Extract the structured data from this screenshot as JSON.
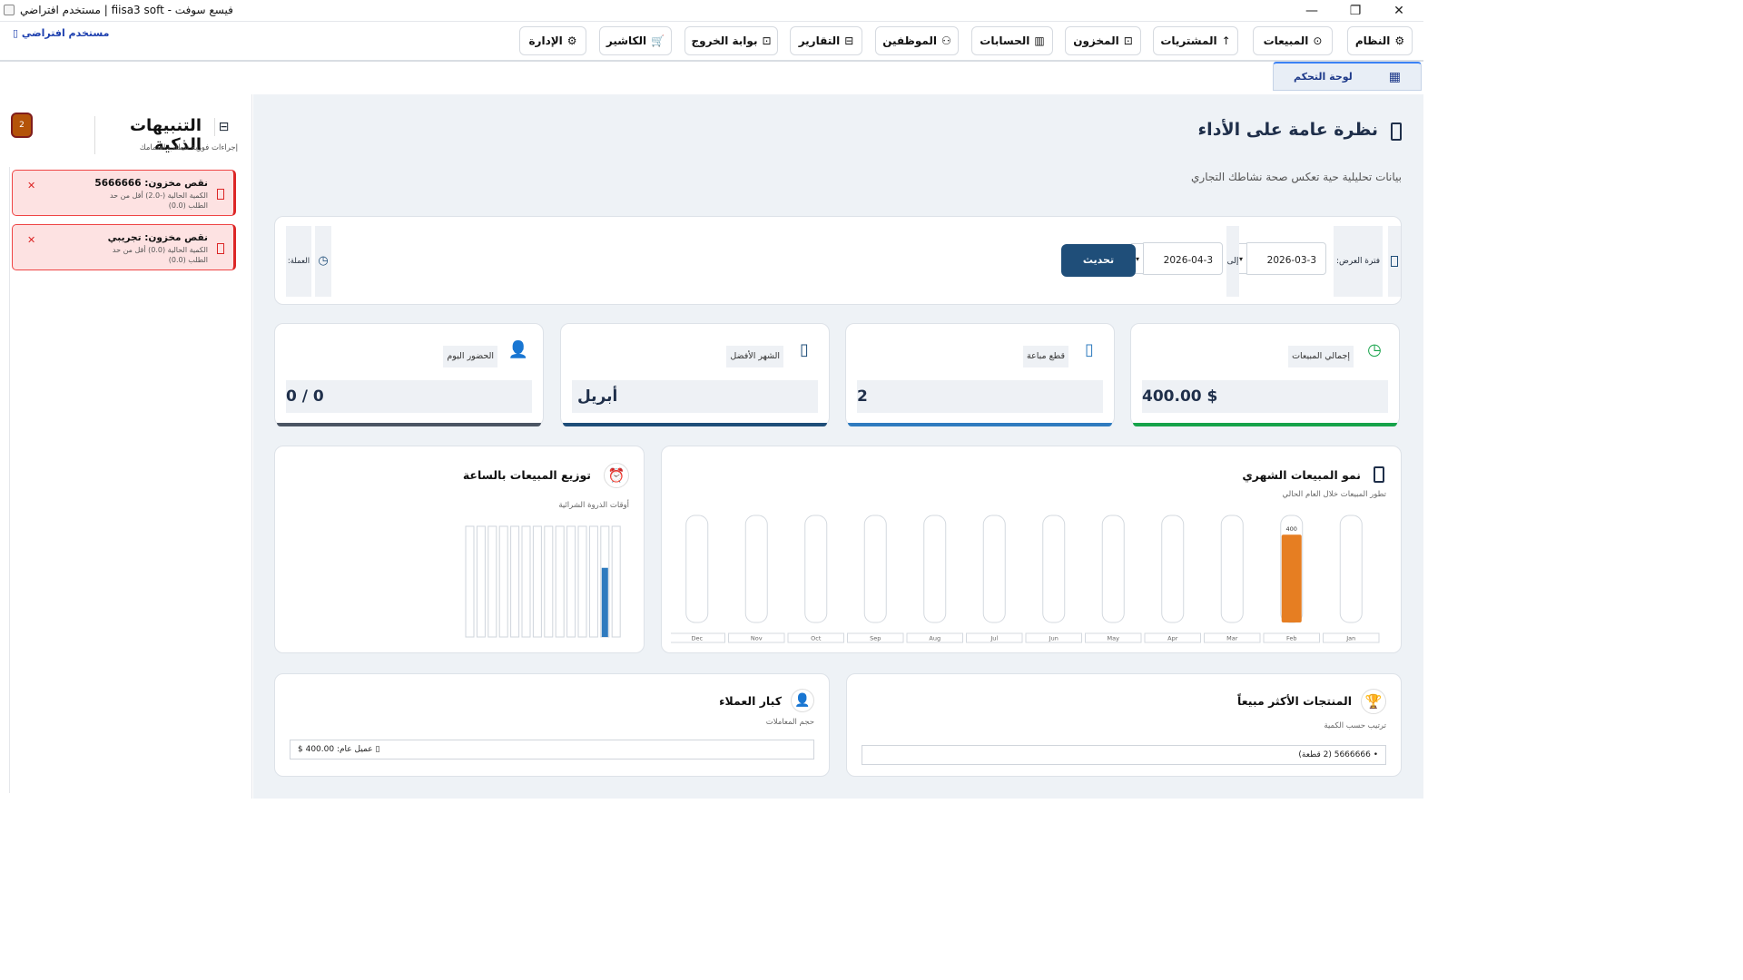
{
  "window": {
    "title": "مستخدم افتراضي | fiisa3 soft - فيسع سوفت",
    "minimize": "—",
    "maximize": "❐",
    "close": "✕"
  },
  "nav": {
    "items": [
      {
        "label": "النظام",
        "icon": "⚙"
      },
      {
        "label": "المبيعات",
        "icon": "⊙"
      },
      {
        "label": "المشتريات",
        "icon": "↑"
      },
      {
        "label": "المخزون",
        "icon": "⊡"
      },
      {
        "label": "الحسابات",
        "icon": "▥"
      },
      {
        "label": "الموظفين",
        "icon": "⚇"
      },
      {
        "label": "التقارير",
        "icon": "⊟"
      },
      {
        "label": "بوابة الخروج",
        "icon": "⊡"
      },
      {
        "label": "الكاشير",
        "icon": "🛒"
      },
      {
        "label": "الإدارة",
        "icon": "⚙"
      }
    ],
    "user_label": "مستخدم افتراضي ▯"
  },
  "tab": {
    "label": "لوحة التحكم",
    "icon": "▦"
  },
  "alerts": {
    "title": "التنبيهات الذكية",
    "subtitle": "إجراءات فورية تتطلب اهتمامك",
    "badge": "2",
    "icon": "⊟",
    "items": [
      {
        "title": "نقص مخزون: 5666666",
        "desc": "الكمية الحالية (-2.0) أقل من حد الطلب (0.0)",
        "close": "✕"
      },
      {
        "title": "نقص مخزون: تجريبي",
        "desc": "الكمية الحالية (0.0) أقل من حد الطلب (0.0)",
        "close": "✕"
      }
    ]
  },
  "main": {
    "title": "نظرة عامة على الأداء",
    "subtitle": "بيانات تحليلية حية تعكس صحة نشاطك التجاري"
  },
  "filter": {
    "period_label": "فترة العرض:",
    "from_date": "2026-03-3",
    "to_label": "إلى",
    "to_date": "2026-04-3",
    "refresh_label": "تحديث",
    "currency_label": "العملة:",
    "dropdown_glyph": "▾",
    "clock_icon": "◷"
  },
  "stats": [
    {
      "label": "إجمالي المبيعات",
      "value": "400.00 $",
      "accent": "#16a34a",
      "icon": "◷"
    },
    {
      "label": "قطع مباعة",
      "value": "2",
      "accent": "#2f7bbf",
      "icon": "▯"
    },
    {
      "label": "الشهر الأفضل",
      "value": "أبريل",
      "accent": "#1f4e79",
      "icon": "▯"
    },
    {
      "label": "الحضور اليوم",
      "value": "0 / 0",
      "accent": "#4b5563",
      "icon": "👤"
    }
  ],
  "hours_chart": {
    "title": "توزيع المبيعات بالساعة",
    "subtitle": "أوقات الذروة الشرائية",
    "icon": "⏰"
  },
  "monthly_chart": {
    "title": "نمو المبيعات الشهري",
    "subtitle": "تطور المبيعات خلال العام الحالي",
    "icon": "▯"
  },
  "chart_data": [
    {
      "type": "bar",
      "title": "نمو المبيعات الشهري",
      "categories": [
        "Jan",
        "Feb",
        "Mar",
        "Apr",
        "May",
        "Jun",
        "Jul",
        "Aug",
        "Sep",
        "Oct",
        "Nov",
        "Dec"
      ],
      "values": [
        0,
        400,
        0,
        0,
        0,
        0,
        0,
        0,
        0,
        0,
        0,
        0
      ],
      "data_labels": [
        "",
        "400",
        "",
        "",
        "",
        "",
        "",
        "",
        "",
        "",
        "",
        ""
      ],
      "bar_color": "#e67e22",
      "ylim": [
        0,
        400
      ],
      "grid": false,
      "legend": "none"
    },
    {
      "type": "bar",
      "title": "توزيع المبيعات بالساعة",
      "categories": [
        "",
        "",
        "",
        "",
        "",
        "",
        "",
        "",
        "",
        "",
        "",
        "",
        "",
        ""
      ],
      "values": [
        0,
        0,
        0,
        0,
        0,
        0,
        0,
        0,
        0,
        0,
        0,
        0,
        1,
        0
      ],
      "bar_color": "#2f7bbf",
      "ylim": [
        0,
        1.6
      ],
      "grid": false,
      "legend": "none"
    }
  ],
  "top_customers": {
    "title": "كبار العملاء",
    "subtitle": "حجم المعاملات",
    "icon": "👤",
    "rows": [
      "$ عميل عام: 400.00 ▯"
    ]
  },
  "top_products": {
    "title": "المنتجات الأكثر مبيعاً",
    "subtitle": "ترتيب حسب الكمية",
    "icon": "🏆",
    "rows": [
      "• 5666666 (2 قطعة)"
    ]
  }
}
